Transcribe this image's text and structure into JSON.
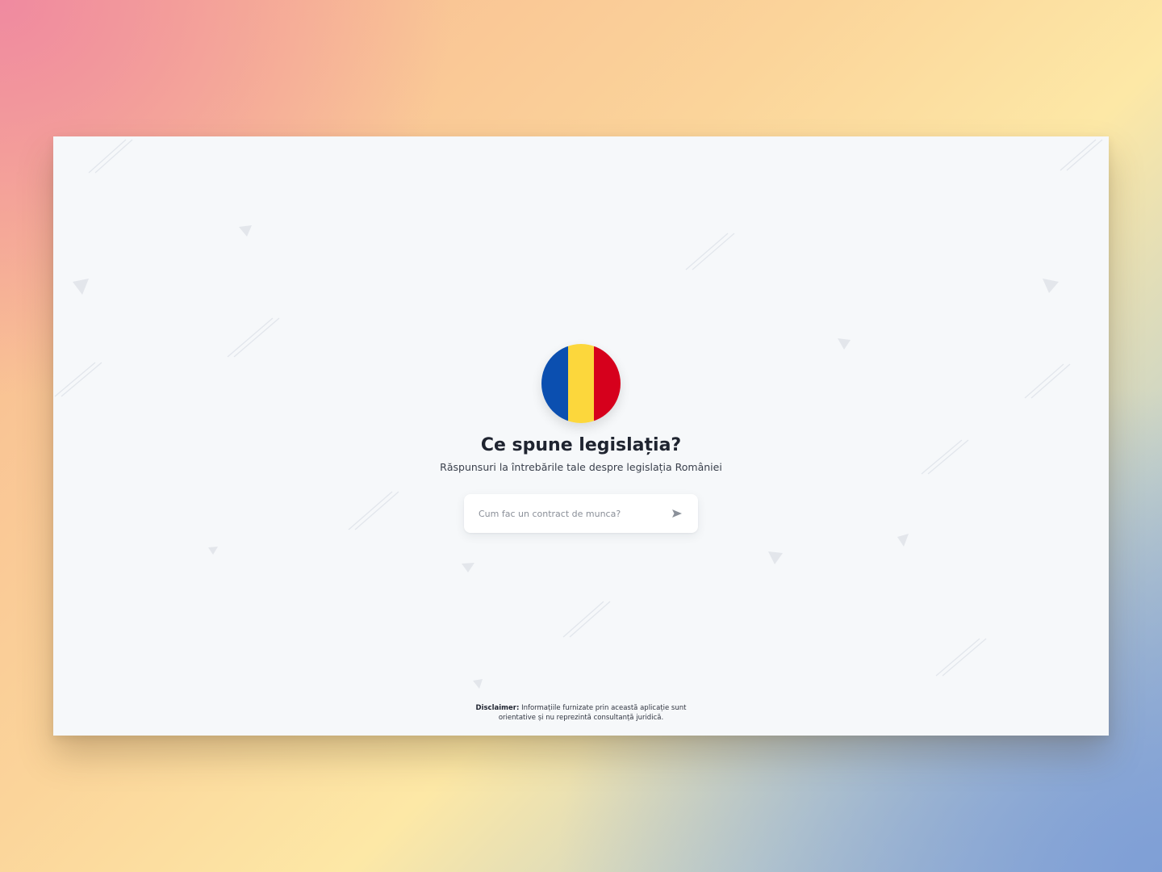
{
  "page": {
    "title": "Ce spune legislația?",
    "subtitle": "Răspunsuri la întrebările tale despre legislația României"
  },
  "flag": {
    "icon": "romania-flag-icon",
    "stripes": [
      "#0b4fb0",
      "#fcd73c",
      "#d6001c"
    ]
  },
  "search": {
    "placeholder": "Cum fac un contract de munca?",
    "value": "",
    "send_icon": "send-arrow-icon"
  },
  "disclaimer": {
    "label": "Disclaimer:",
    "line1": "Informațiile furnizate prin această aplicație sunt",
    "line2": "orientative și nu reprezintă consultanță juridică."
  },
  "colors": {
    "window_background": "#f6f8fa",
    "heading": "#1f2430"
  }
}
